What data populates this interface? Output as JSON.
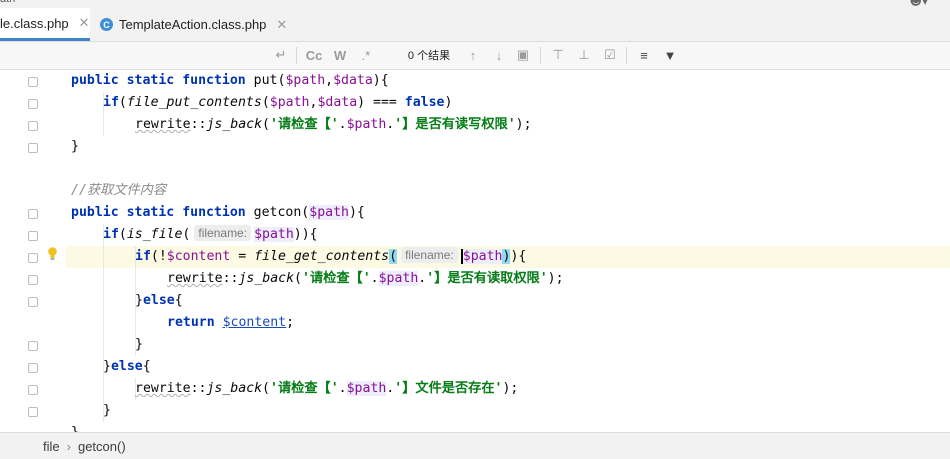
{
  "window": {
    "path_fragment": "ath"
  },
  "tabs": [
    {
      "label": "le.class.php",
      "active": true
    },
    {
      "label": "TemplateAction.class.php",
      "active": false,
      "icon": "php-class-icon"
    }
  ],
  "findbar": {
    "match_case": "Cc",
    "words": "W",
    "regex": ".*",
    "result_count": "0 个结果"
  },
  "code": {
    "line1": {
      "kw1": "public",
      "kw2": "static",
      "kw3": "function",
      "name": "put(",
      "v1": "$path",
      "comma": ",",
      "v2": "$data",
      "end": "){"
    },
    "line2": {
      "kw": "if",
      "open": "(",
      "fn": "file_put_contents",
      "p": "(",
      "v1": "$path",
      "comma": ",",
      "v2": "$data",
      "mid": ") === ",
      "kw2": "false",
      "close": ")"
    },
    "line3": {
      "cls": "rewrite",
      "op": "::",
      "fn": "js_back",
      "p": "(",
      "s1": "'请检查【'",
      "dot1": ".",
      "v": "$path",
      "dot2": ".",
      "s2": "'】是否有读写权限'",
      "end": ");"
    },
    "line4": "}",
    "line6": "//获取文件内容",
    "line7": {
      "kw1": "public",
      "kw2": "static",
      "kw3": "function",
      "name": "getcon(",
      "v": "$path",
      "end": "){"
    },
    "line8": {
      "kw": "if",
      "p": "(",
      "fn": "is_file",
      "p2": "(",
      "hint": "filename:",
      "v": "$path",
      "end": ")){"
    },
    "line9": {
      "kw": "if",
      "p": "(!",
      "v": "$content",
      "eq": " = ",
      "fn": "file_get_contents",
      "lp": "(",
      "hint": "filename:",
      "v2": "$path",
      "rp": ")",
      "end": "){"
    },
    "line10": {
      "cls": "rewrite",
      "op": "::",
      "fn": "js_back",
      "p": "(",
      "s1": "'请检查【'",
      "dot1": ".",
      "v": "$path",
      "dot2": ".",
      "s2": "'】是否有读取权限'",
      "end": ");"
    },
    "line11": {
      "pre": "}",
      "kw": "else",
      "end": "{"
    },
    "line12": {
      "kw": "return",
      "v": "$content",
      "end": ";"
    },
    "line13": "}",
    "line14": {
      "pre": "}",
      "kw": "else",
      "end": "{"
    },
    "line15": {
      "cls": "rewrite",
      "op": "::",
      "fn": "js_back",
      "p": "(",
      "s1": "'请检查【'",
      "dot1": ".",
      "v": "$path",
      "dot2": ".",
      "s2": "'】文件是否存在'",
      "end": ");"
    },
    "line16": "}",
    "line17": "}"
  },
  "statusbar": {
    "crumb1": "file",
    "sep": "›",
    "crumb2": "getcon()"
  },
  "colors": {
    "keyword": "#0033b3",
    "variable": "#871094",
    "string": "#067d17",
    "comment": "#8c8c8c",
    "current_line": "#fcfae3",
    "tab_underline": "#4083c9"
  }
}
